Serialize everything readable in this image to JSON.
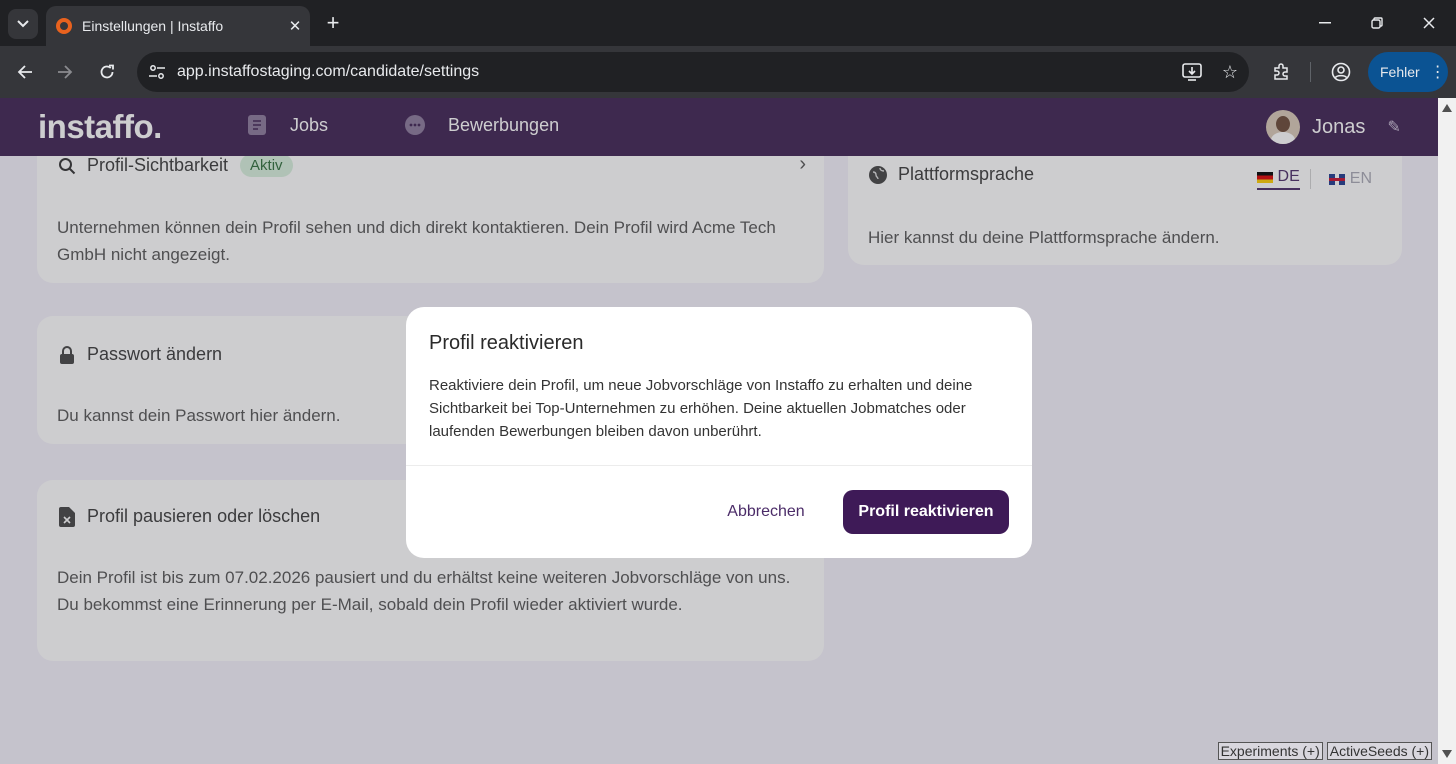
{
  "browser": {
    "tab_title": "Einstellungen | Instaffo",
    "url": "app.instaffostaging.com/candidate/settings",
    "error_label": "Fehler"
  },
  "header": {
    "logo": "instaffo.",
    "nav": [
      {
        "label": "Jobs",
        "icon": "document-icon"
      },
      {
        "label": "Bewerbungen",
        "icon": "chat-icon"
      }
    ],
    "user_name": "Jonas"
  },
  "cards": {
    "visibility": {
      "title": "Profil-Sichtbarkeit",
      "badge": "Aktiv",
      "body": "Unternehmen können dein Profil sehen und dich direkt kontaktieren. Dein Profil wird Acme Tech GmbH nicht angezeigt."
    },
    "language": {
      "title": "Plattformsprache",
      "body": "Hier kannst du deine Plattformsprache ändern.",
      "options": [
        "DE",
        "EN"
      ],
      "selected": "DE"
    },
    "password": {
      "title": "Passwort ändern",
      "body": "Du kannst dein Passwort hier ändern."
    },
    "pause": {
      "title": "Profil pausieren oder löschen",
      "body": "Dein Profil ist bis zum 07.02.2026 pausiert und du erhältst keine weiteren Jobvorschläge von uns. Du bekommst eine Erinnerung per E-Mail, sobald dein Profil wieder aktiviert wurde."
    }
  },
  "modal": {
    "title": "Profil reaktivieren",
    "text": "Reaktiviere dein Profil, um neue Jobvorschläge von Instaffo zu erhalten und deine Sichtbarkeit bei Top-Unternehmen zu erhöhen. Deine aktuellen Jobmatches oder laufenden Bewerbungen bleiben davon unberührt.",
    "cancel_label": "Abbrechen",
    "confirm_label": "Profil reaktivieren"
  },
  "debug": {
    "experiments": "Experiments (+)",
    "active_seeds": "ActiveSeeds (+)"
  },
  "colors": {
    "brand": "#3e2253",
    "primary_button": "#3e1a57",
    "badge_bg": "#d8f1dd",
    "page_bg": "#f5f2fb"
  }
}
